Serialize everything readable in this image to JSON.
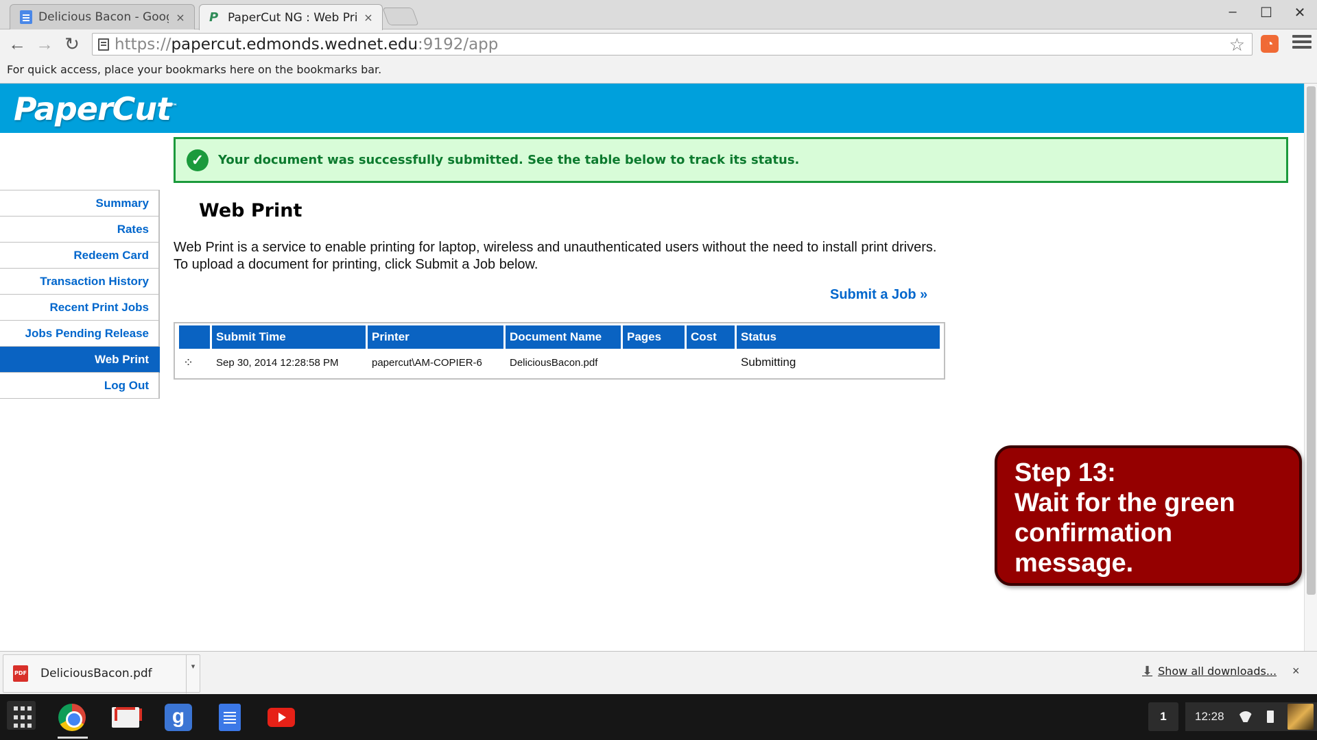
{
  "browser": {
    "tabs": [
      {
        "title": "Delicious Bacon - Google",
        "icon": "docs-icon",
        "active": false
      },
      {
        "title": "PaperCut NG : Web Print",
        "icon": "papercut-icon",
        "active": true
      }
    ],
    "tab_close": "×",
    "url": {
      "scheme": "https://",
      "host": "papercut.edmonds.wednet.edu",
      "path": ":9192/app"
    },
    "bookmarks_hint": "For quick access, place your bookmarks here on the bookmarks bar.",
    "window_controls": {
      "minimize": "–",
      "maximize": "☐",
      "close": "✕"
    }
  },
  "papercut": {
    "logo": "PaperCut",
    "logo_tm": "™",
    "brand_color": "#00a0dc",
    "success_message": "Your document was successfully submitted. See the table below to track its status.",
    "success_color": "#1b9a3c",
    "nav": [
      {
        "label": "Summary",
        "active": false
      },
      {
        "label": "Rates",
        "active": false
      },
      {
        "label": "Redeem Card",
        "active": false
      },
      {
        "label": "Transaction History",
        "active": false
      },
      {
        "label": "Recent Print Jobs",
        "active": false
      },
      {
        "label": "Jobs Pending Release",
        "active": false
      },
      {
        "label": "Web Print",
        "active": true
      },
      {
        "label": "Log Out",
        "active": false
      }
    ],
    "page_title": "Web Print",
    "intro": "Web Print is a service to enable printing for laptop, wireless and unauthenticated users without the need to install print drivers. To upload a document for printing, click Submit a Job below.",
    "submit_link": "Submit a Job »",
    "table": {
      "headers": [
        "",
        "Submit Time",
        "Printer",
        "Document Name",
        "Pages",
        "Cost",
        "Status"
      ],
      "rows": [
        {
          "submit_time": "Sep 30, 2014 12:28:58 PM",
          "printer": "papercut\\AM-COPIER-6",
          "document": "DeliciousBacon.pdf",
          "pages": "",
          "cost": "",
          "status": "Submitting"
        }
      ]
    }
  },
  "callout": {
    "lines": [
      "Step 13:",
      "Wait for the green",
      "confirmation",
      "message."
    ],
    "color": "#950000"
  },
  "downloads": {
    "file": "DeliciousBacon.pdf",
    "file_icon_text": "PDF",
    "show_all": "Show all downloads...",
    "close": "×"
  },
  "shelf": {
    "apps": [
      "chrome-icon",
      "gmail-icon",
      "google-plus-icon",
      "docs-icon",
      "youtube-icon"
    ],
    "notification_count": "1",
    "time": "12:28"
  }
}
